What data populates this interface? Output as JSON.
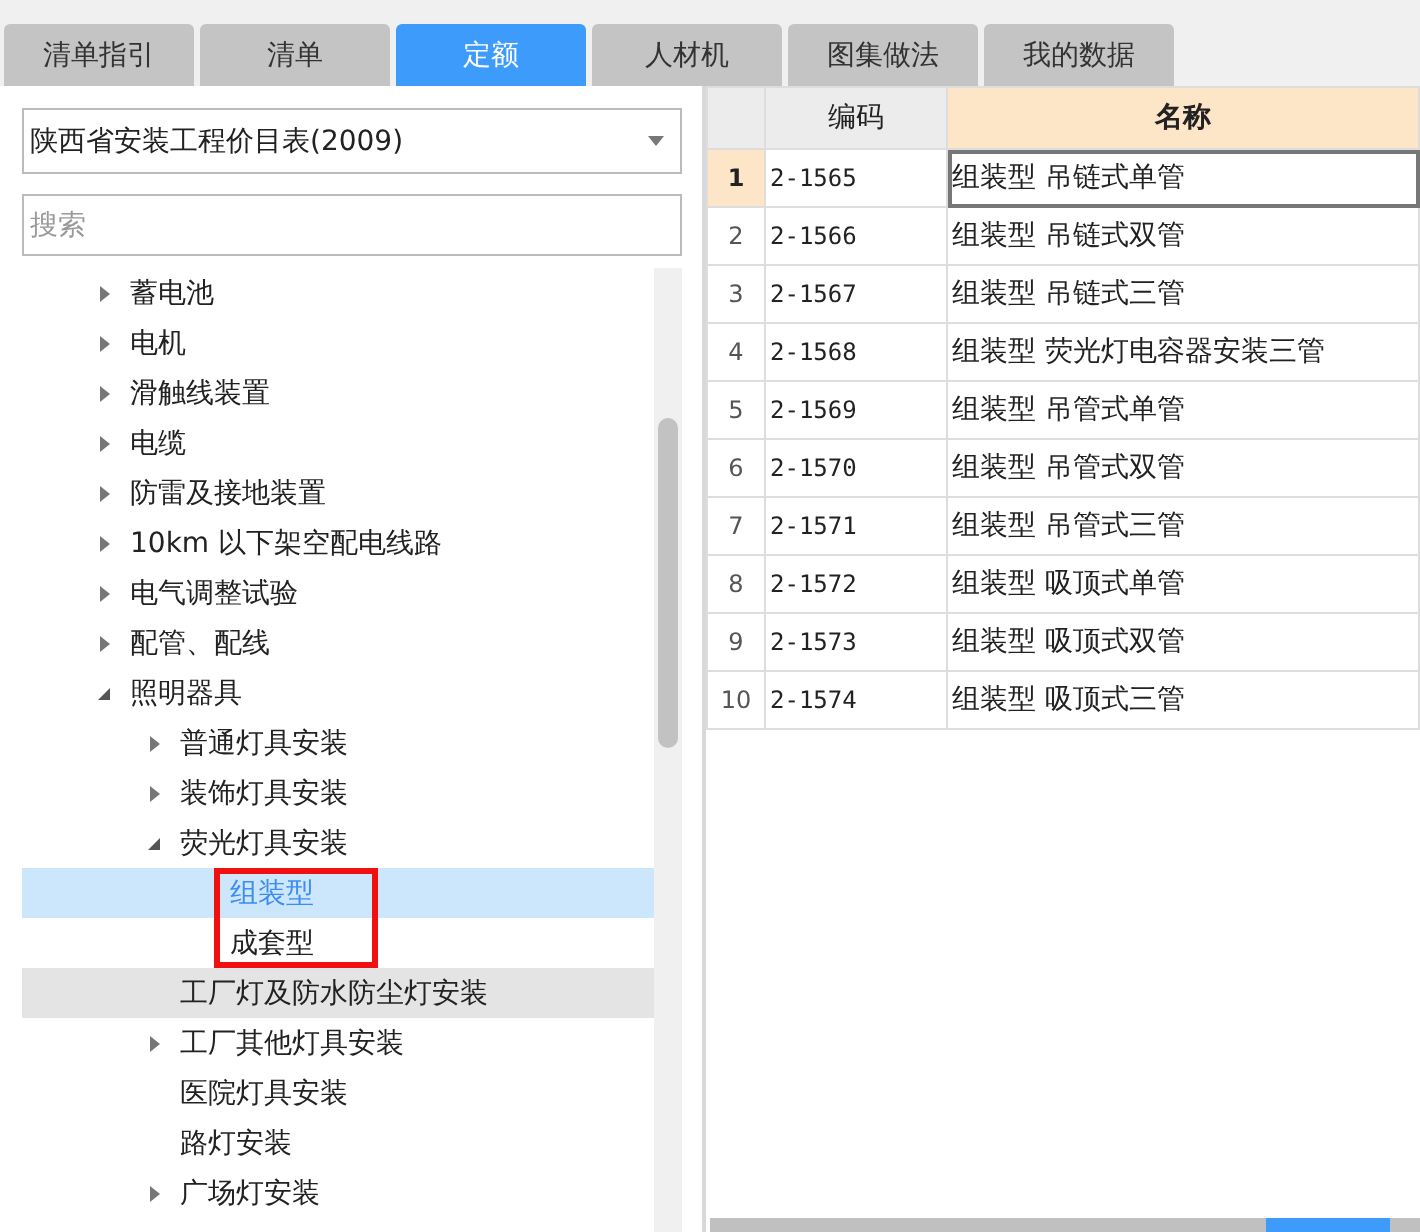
{
  "tabs": [
    {
      "label": "清单指引",
      "selected": false
    },
    {
      "label": "清单",
      "selected": false
    },
    {
      "label": "定额",
      "selected": true
    },
    {
      "label": "人材机",
      "selected": false
    },
    {
      "label": "图集做法",
      "selected": false
    },
    {
      "label": "我的数据",
      "selected": false
    }
  ],
  "library_select": {
    "value": "陕西省安装工程价目表(2009)"
  },
  "search": {
    "placeholder": "搜索"
  },
  "tree": [
    {
      "label": "蓄电池",
      "kind": "folder",
      "expanded": false,
      "selected": false,
      "highlighted": false
    },
    {
      "label": "电机",
      "kind": "folder",
      "expanded": false,
      "selected": false,
      "highlighted": false
    },
    {
      "label": "滑触线装置",
      "kind": "folder",
      "expanded": false,
      "selected": false,
      "highlighted": false
    },
    {
      "label": "电缆",
      "kind": "folder",
      "expanded": false,
      "selected": false,
      "highlighted": false
    },
    {
      "label": "防雷及接地装置",
      "kind": "folder",
      "expanded": false,
      "selected": false,
      "highlighted": false
    },
    {
      "label": "10km 以下架空配电线路",
      "kind": "folder",
      "expanded": false,
      "selected": false,
      "highlighted": false
    },
    {
      "label": "电气调整试验",
      "kind": "folder",
      "expanded": false,
      "selected": false,
      "highlighted": false
    },
    {
      "label": "配管、配线",
      "kind": "folder",
      "expanded": false,
      "selected": false,
      "highlighted": false
    },
    {
      "label": "照明器具",
      "kind": "folder",
      "expanded": true,
      "selected": false,
      "highlighted": false,
      "children": [
        {
          "label": "普通灯具安装",
          "kind": "folder",
          "expanded": false,
          "selected": false,
          "highlighted": false
        },
        {
          "label": "装饰灯具安装",
          "kind": "folder",
          "expanded": false,
          "selected": false,
          "highlighted": false
        },
        {
          "label": "荧光灯具安装",
          "kind": "folder",
          "expanded": true,
          "selected": false,
          "highlighted": false,
          "children_marked": true,
          "children": [
            {
              "label": "组装型",
              "kind": "leaf",
              "selected": true,
              "highlighted": false
            },
            {
              "label": "成套型",
              "kind": "leaf",
              "selected": false,
              "highlighted": false
            }
          ]
        },
        {
          "label": "工厂灯及防水防尘灯安装",
          "kind": "leaf",
          "selected": false,
          "highlighted": true
        },
        {
          "label": "工厂其他灯具安装",
          "kind": "folder",
          "expanded": false,
          "selected": false,
          "highlighted": false
        },
        {
          "label": "医院灯具安装",
          "kind": "leaf",
          "selected": false,
          "highlighted": false
        },
        {
          "label": "路灯安装",
          "kind": "leaf",
          "selected": false,
          "highlighted": false
        },
        {
          "label": "广场灯安装",
          "kind": "folder",
          "expanded": false,
          "selected": false,
          "highlighted": false
        }
      ]
    }
  ],
  "table": {
    "columns": [
      "编码",
      "名称"
    ],
    "rows": [
      {
        "index": "1",
        "code": "2-1565",
        "name": "组装型 吊链式单管",
        "selected": true
      },
      {
        "index": "2",
        "code": "2-1566",
        "name": "组装型 吊链式双管",
        "selected": false
      },
      {
        "index": "3",
        "code": "2-1567",
        "name": "组装型 吊链式三管",
        "selected": false
      },
      {
        "index": "4",
        "code": "2-1568",
        "name": "组装型 荧光灯电容器安装三管",
        "selected": false
      },
      {
        "index": "5",
        "code": "2-1569",
        "name": "组装型 吊管式单管",
        "selected": false
      },
      {
        "index": "6",
        "code": "2-1570",
        "name": "组装型 吊管式双管",
        "selected": false
      },
      {
        "index": "7",
        "code": "2-1571",
        "name": "组装型 吊管式三管",
        "selected": false
      },
      {
        "index": "8",
        "code": "2-1572",
        "name": "组装型 吸顶式单管",
        "selected": false
      },
      {
        "index": "9",
        "code": "2-1573",
        "name": "组装型 吸顶式双管",
        "selected": false
      },
      {
        "index": "10",
        "code": "2-1574",
        "name": "组装型 吸顶式三管",
        "selected": false
      }
    ]
  }
}
